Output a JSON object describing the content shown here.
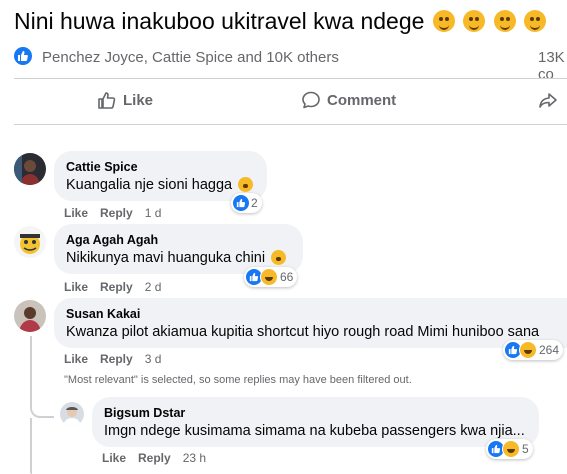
{
  "post": {
    "text": "Nini huwa inakuboo ukitravel kwa ndege",
    "emojis": [
      "kissing-heart-icon",
      "kissing-heart-icon",
      "kissing-heart-icon",
      "joy-icon"
    ]
  },
  "summary": {
    "names": "Penchez Joyce, Cattie Spice and 10K others",
    "count": "13K co"
  },
  "actions": {
    "like": "Like",
    "comment": "Comment"
  },
  "comments": [
    {
      "author": "Cattie Spice",
      "text": "Kuangalia nje sioni hagga",
      "like": "Like",
      "reply": "Reply",
      "time": "1 d",
      "reactions": "2"
    },
    {
      "author": "Aga Agah Agah",
      "text": "Nikikunya mavi huanguka chini",
      "like": "Like",
      "reply": "Reply",
      "time": "2 d",
      "reactions": "66"
    },
    {
      "author": "Susan Kakai",
      "text": "Kwanza pilot akiamua kupitia shortcut hiyo rough road Mimi huniboo sana",
      "like": "Like",
      "reply": "Reply",
      "time": "3 d",
      "reactions": "264"
    }
  ],
  "notice": "\"Most relevant\" is selected, so some replies may have been filtered out.",
  "reply": {
    "author": "Bigsum Dstar",
    "text": "Imgn ndege kusimama simama na kubeba passengers kwa njia...",
    "like": "Like",
    "reply": "Reply",
    "time": "23 h",
    "reactions": "5"
  },
  "colors": {
    "accent": "#1877f2",
    "bubble": "#f0f2f5",
    "muted": "#65676b"
  }
}
